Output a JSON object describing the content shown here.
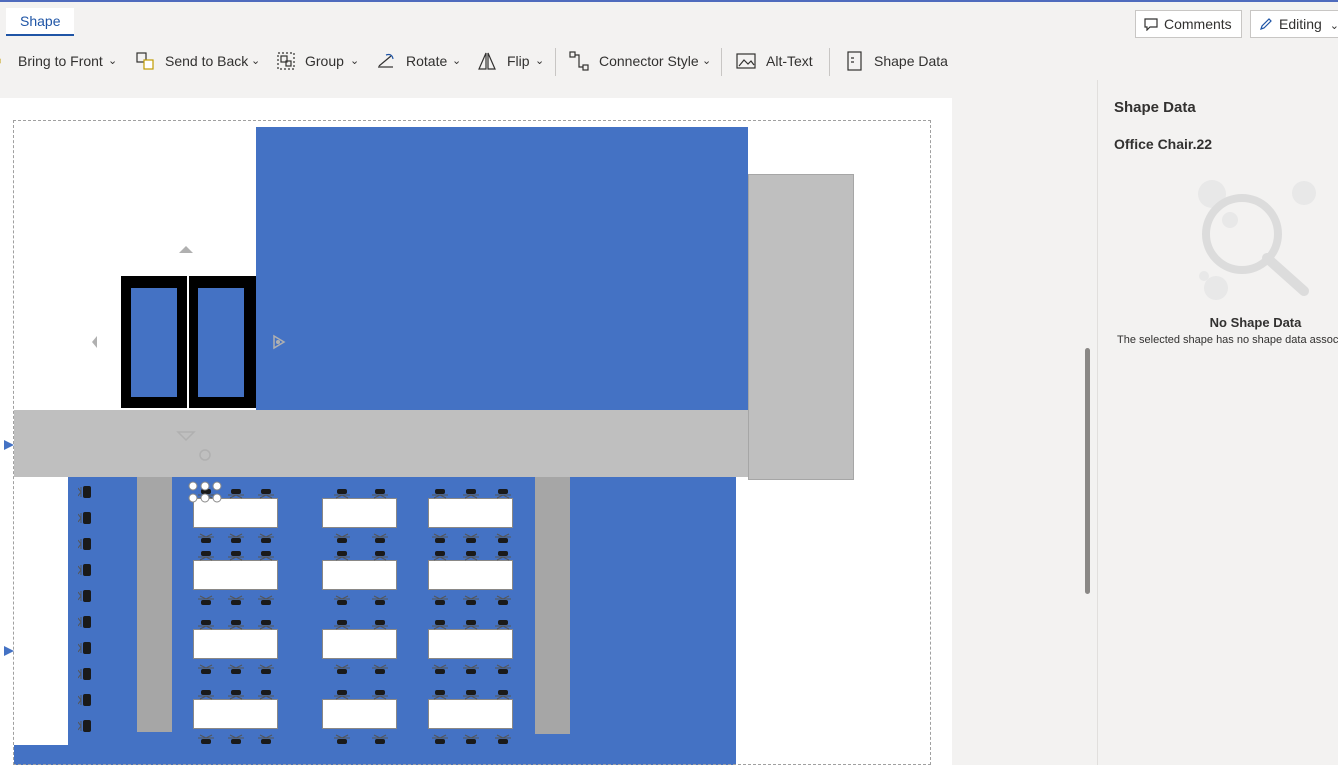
{
  "tabs": {
    "active": "Shape"
  },
  "top_buttons": {
    "comments": "Comments",
    "editing": "Editing"
  },
  "toolbar": {
    "bring_to_front": "Bring to Front",
    "send_to_back": "Send to Back",
    "group": "Group",
    "rotate": "Rotate",
    "flip": "Flip",
    "connector_style": "Connector Style",
    "alt_text": "Alt-Text",
    "shape_data": "Shape Data"
  },
  "panel": {
    "title": "Shape Data",
    "selected_shape": "Office Chair.22",
    "empty_title": "No Shape Data",
    "empty_text": "The selected shape has no shape data associated with it."
  },
  "colors": {
    "accent": "#1f55a6",
    "floor_blue": "#4472c4",
    "wall_gray": "#bfbfbf",
    "column_gray": "#a6a6a6"
  }
}
